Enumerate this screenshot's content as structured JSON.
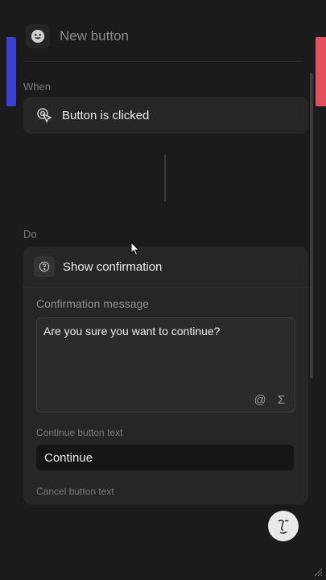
{
  "header": {
    "title": "New button"
  },
  "when": {
    "label": "When",
    "trigger": {
      "label": "Button is clicked",
      "icon": "touch-click-icon"
    }
  },
  "do": {
    "label": "Do",
    "action": {
      "title": "Show confirmation",
      "icon": "question-circle-icon",
      "confirmation_message": {
        "label": "Confirmation message",
        "value": "Are you sure you want to continue?",
        "tools": {
          "mention": "@",
          "formula": "Σ"
        }
      },
      "continue_button": {
        "label": "Continue button text",
        "value": "Continue"
      },
      "cancel_button": {
        "label": "Cancel button text"
      }
    }
  },
  "colors": {
    "background": "#1b1b1b",
    "card": "#262626",
    "accent_left": "#3a3fd0",
    "accent_right": "#e3525c"
  }
}
